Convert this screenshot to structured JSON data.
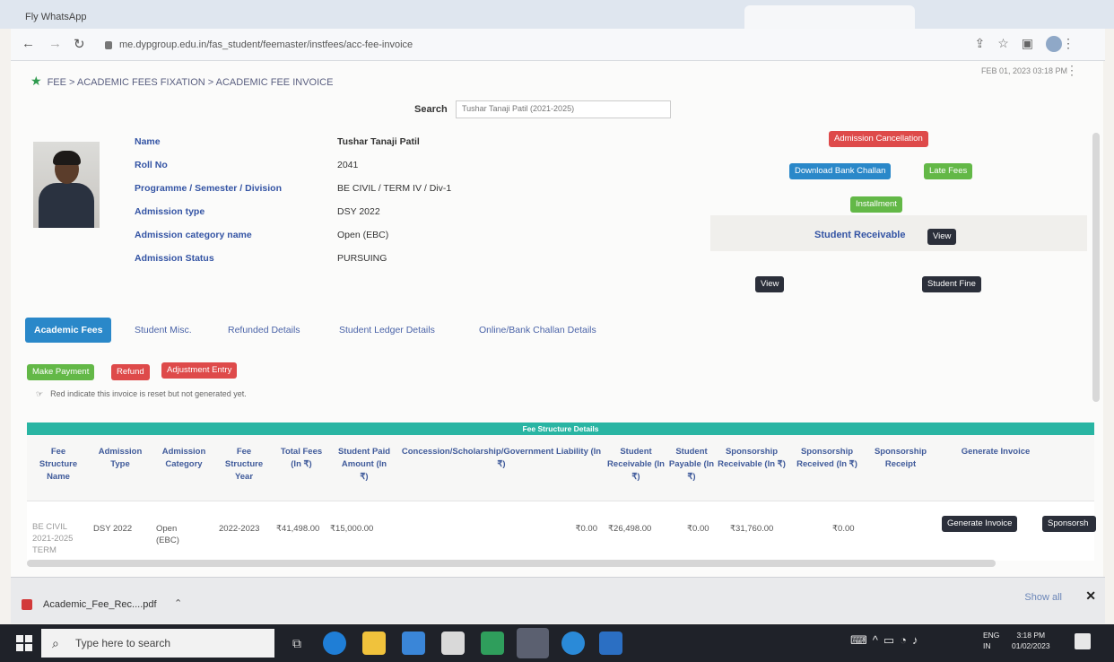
{
  "browser": {
    "tabs": [
      "Fly WhatsApp",
      "",
      "",
      "",
      ""
    ],
    "url": "me.dypgroup.edu.in/fas_student/feemaster/instfees/acc-fee-invoice"
  },
  "page": {
    "breadcrumb": "FEE > ACADEMIC FEES FIXATION > ACADEMIC FEE INVOICE",
    "datetime": "FEB 01, 2023 03:18 PM",
    "search_label": "Search",
    "search_value": "Tushar Tanaji Patil (2021-2025)",
    "student": {
      "fields": [
        {
          "label": "Name",
          "value": "Tushar Tanaji Patil"
        },
        {
          "label": "Roll No",
          "value": "2041"
        },
        {
          "label": "Programme  /  Semester  /  Division",
          "value": "BE CIVIL  /  TERM IV  /  Div-1"
        },
        {
          "label": "Admission type",
          "value": "DSY 2022"
        },
        {
          "label": "Admission category name",
          "value": "Open (EBC)"
        },
        {
          "label": "Admission Status",
          "value": "PURSUING"
        }
      ]
    },
    "buttons": {
      "admission_cancellation": "Admission Cancellation",
      "download_bank_challan": "Download Bank Challan",
      "late_fees": "Late Fees",
      "installment": "Installment",
      "student_receivable_label": "Student Receivable",
      "view1": "View",
      "view2": "View",
      "student_fine": "Student Fine",
      "make_payment": "Make Payment",
      "refund": "Refund",
      "adjustment_entry": "Adjustment Entry"
    },
    "tabs": [
      "Academic Fees",
      "Student Misc.",
      "Refunded Details",
      "Student Ledger Details",
      "Online/Bank Challan Details"
    ],
    "hint": "Red indicate this invoice is reset but not generated yet.",
    "fee_structure": {
      "title": "Fee Structure Details",
      "headers": [
        "Fee Structure Name",
        "Admission Type",
        "Admission Category",
        "Fee Structure Year",
        "Total Fees (In ₹)",
        "Student Paid Amount (In ₹)",
        "Concession/Scholarship/Government Liability (In ₹)",
        "Student Receivable (In ₹)",
        "Student Payable (In ₹)",
        "Sponsorship Receivable (In ₹)",
        "Sponsorship Received (In ₹)",
        "Sponsorship Receipt",
        "Generate Invoice"
      ],
      "row": {
        "name": "BE CIVIL 2021-2025 TERM",
        "admission_type": "DSY 2022",
        "category": "Open (EBC)",
        "year": "2022-2023",
        "total_fees": "₹41,498.00",
        "paid": "₹15,000.00",
        "concession": "₹0.00",
        "receivable": "₹26,498.00",
        "payable": "₹0.00",
        "sponsor_receivable": "₹31,760.00",
        "sponsor_received": "₹0.00",
        "generate_invoice": "Generate Invoice",
        "sponsorship": "Sponsorsh"
      }
    }
  },
  "downloads": {
    "file": "Academic_Fee_Rec....pdf",
    "show_all": "Show all"
  },
  "taskbar": {
    "search_placeholder": "Type here to search",
    "lang_top": "ENG",
    "lang_bottom": "IN",
    "time": "3:18 PM",
    "date": "01/02/2023"
  }
}
